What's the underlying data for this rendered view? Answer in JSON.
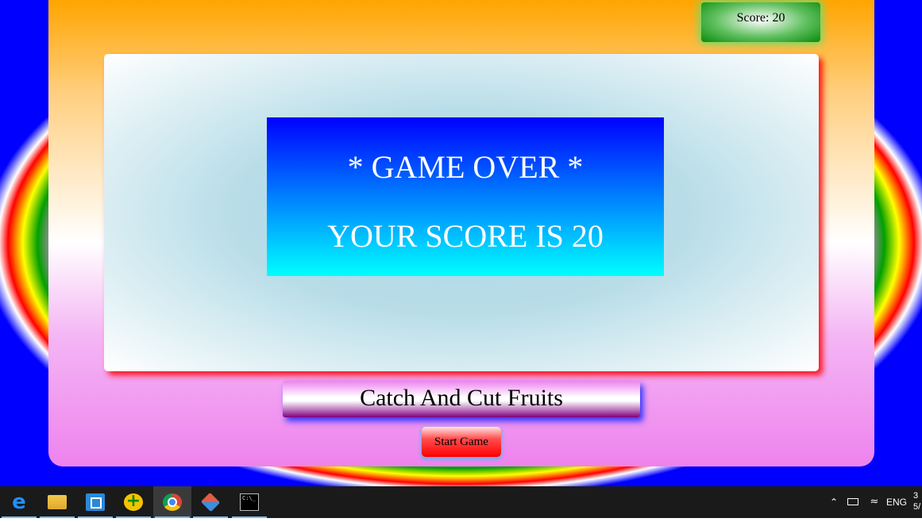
{
  "game": {
    "score_label": "Score: 20",
    "game_over_line1": "* GAME OVER *",
    "game_over_line2": "YOUR SCORE IS 20",
    "title": "Catch And Cut Fruits",
    "start_button_label": "Start Game"
  },
  "colors": {
    "score_box": "#0a8a0a",
    "game_over_top": "#0000ff",
    "game_over_bottom": "#00ffff",
    "start_button": "#ff0000",
    "game_area_shadow": "#ff0000"
  },
  "taskbar": {
    "apps": [
      {
        "icon": "edge-icon"
      },
      {
        "icon": "file-explorer-icon"
      },
      {
        "icon": "store-icon"
      },
      {
        "icon": "app-plus-icon"
      },
      {
        "icon": "chrome-icon"
      },
      {
        "icon": "git-icon"
      },
      {
        "icon": "terminal-icon"
      }
    ],
    "tray": {
      "language": "ENG",
      "clock_line1": "3",
      "clock_line2": "5/"
    }
  }
}
